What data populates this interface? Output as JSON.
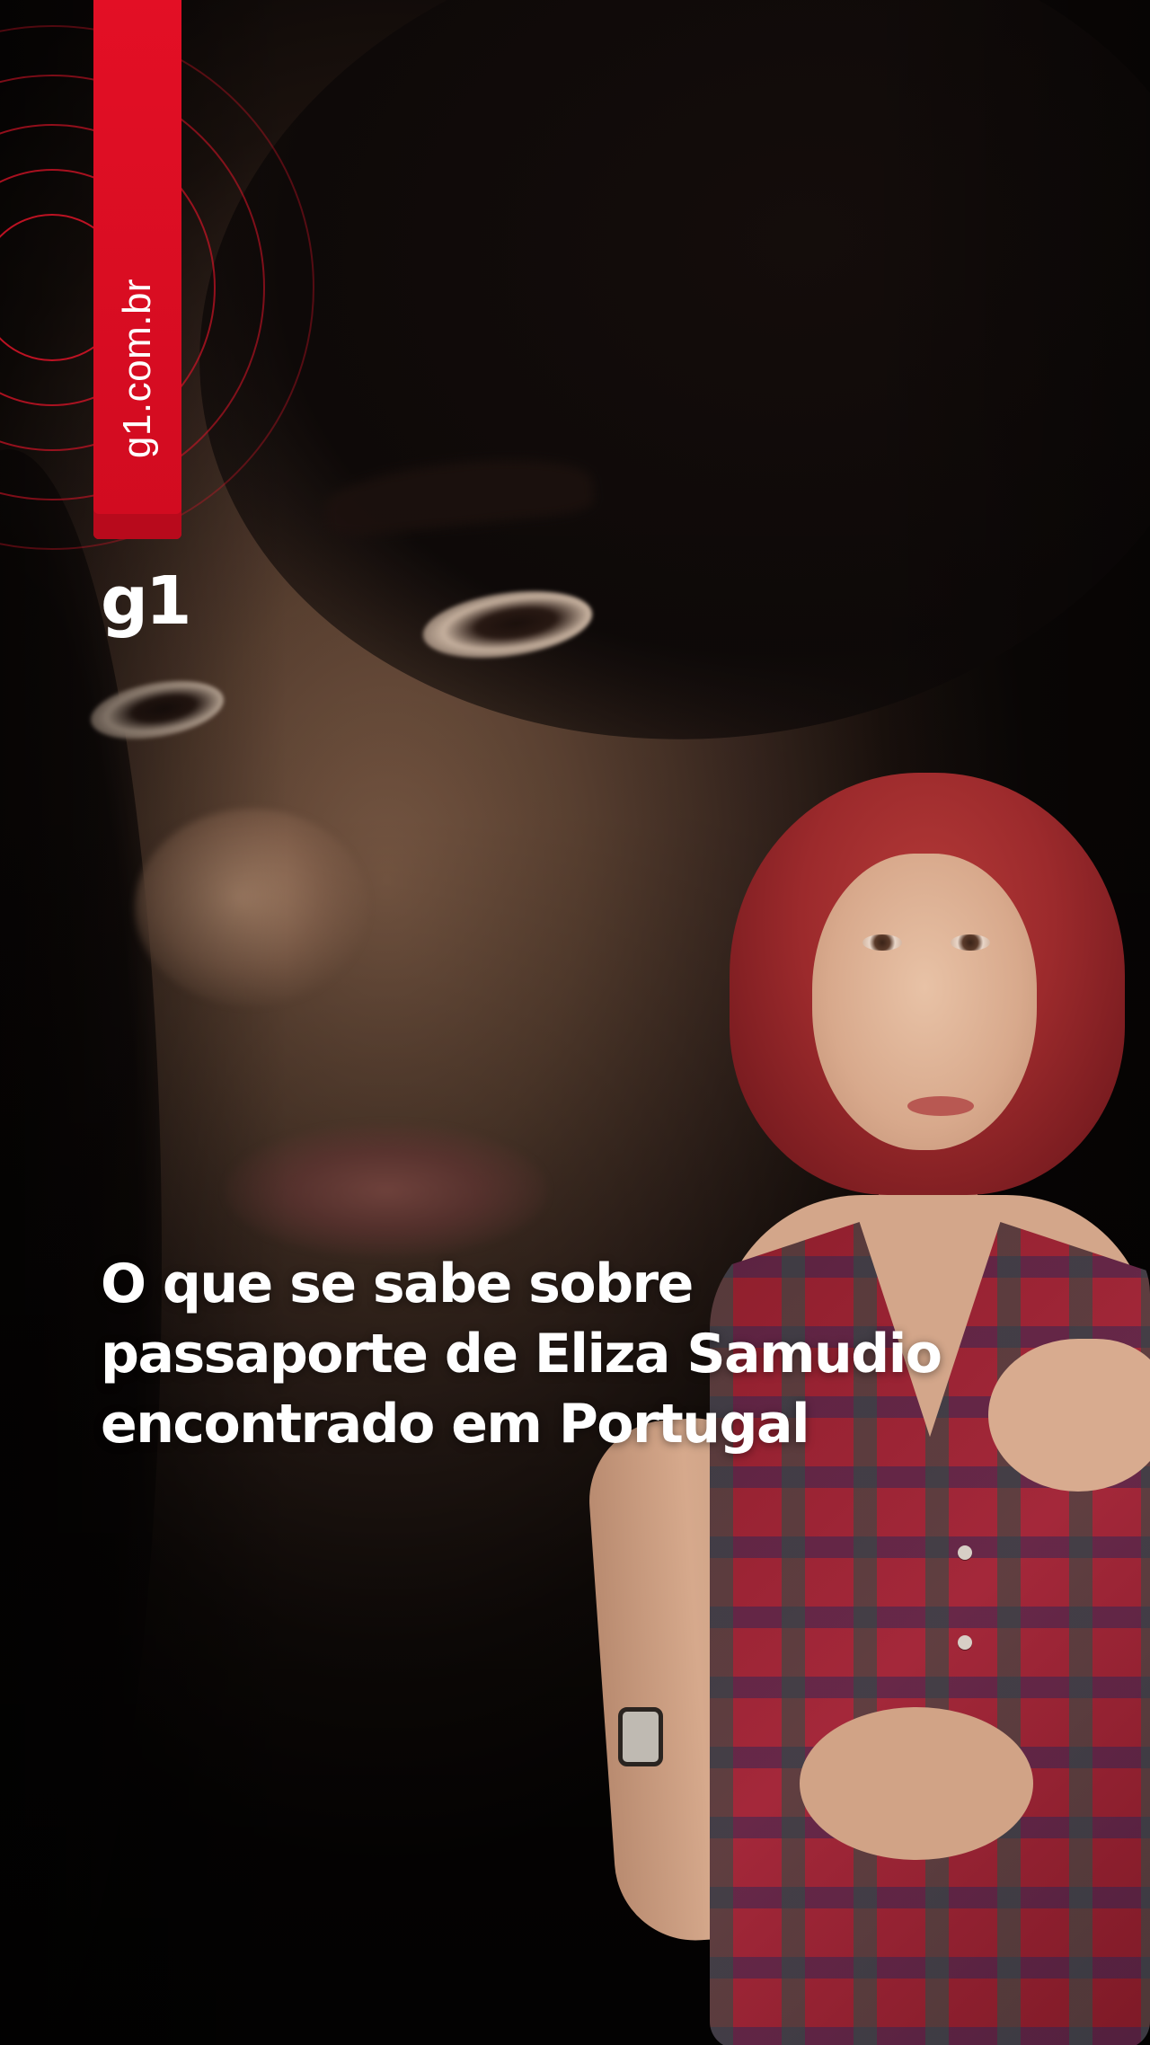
{
  "brand": {
    "domain_label": "g1.com.br",
    "logo_text": "g1",
    "accent_color": "#e30f25"
  },
  "headline": {
    "lines": [
      "O que se sabe sobre",
      "passaporte de Eliza Samudio",
      "encontrado em Portugal"
    ],
    "color": "#ffffff"
  },
  "background": {
    "description_icons": [
      "background-portrait",
      "presenter-figure"
    ]
  }
}
